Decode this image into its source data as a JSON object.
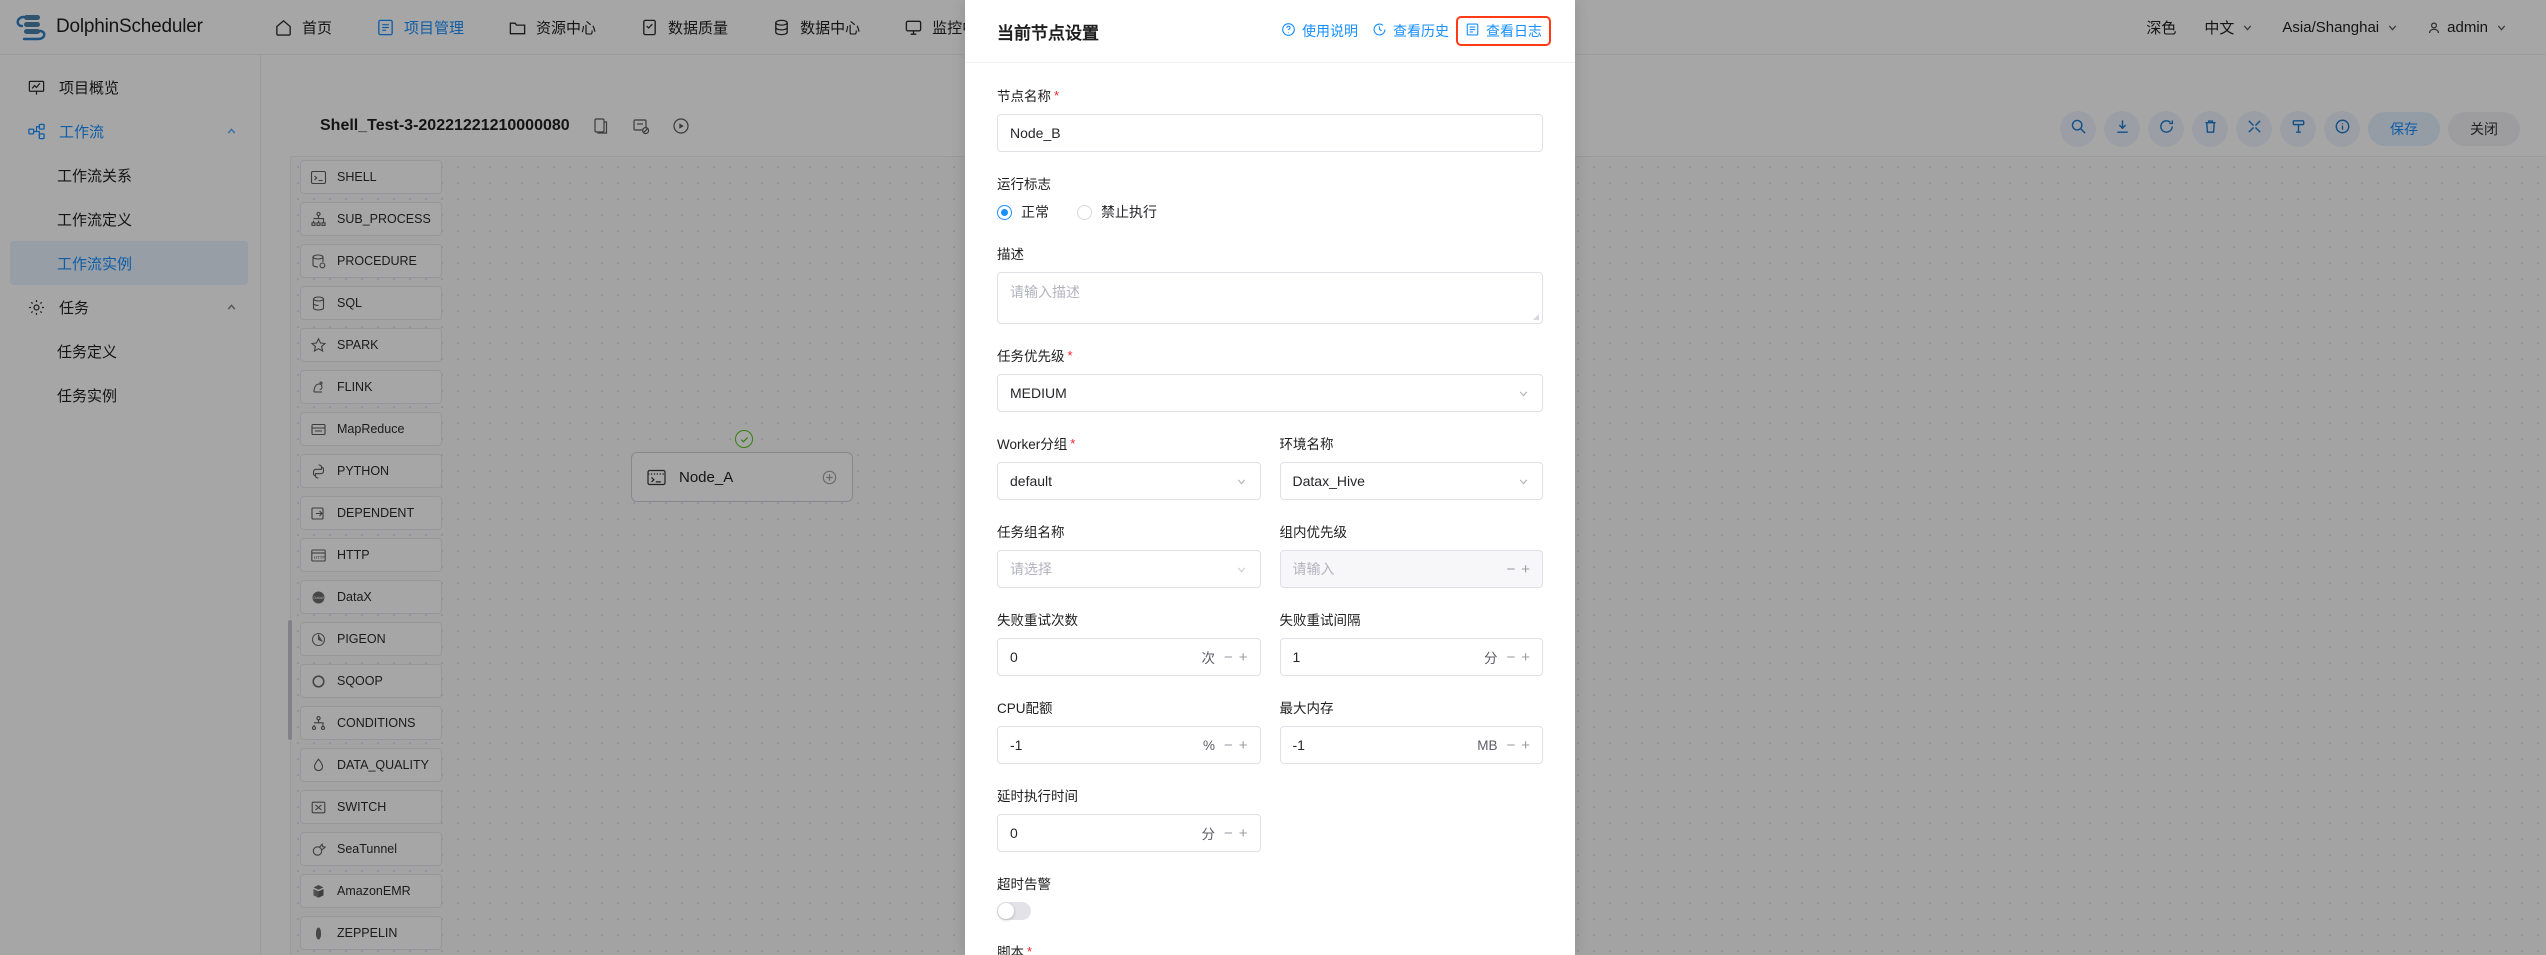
{
  "header": {
    "brand": "DolphinScheduler",
    "nav": [
      {
        "label": "首页",
        "icon": "home-icon",
        "active": false
      },
      {
        "label": "项目管理",
        "icon": "project-icon",
        "active": true
      },
      {
        "label": "资源中心",
        "icon": "folder-icon",
        "active": false
      },
      {
        "label": "数据质量",
        "icon": "quality-icon",
        "active": false
      },
      {
        "label": "数据中心",
        "icon": "datasource-icon",
        "active": false
      },
      {
        "label": "监控中心",
        "icon": "monitor-icon",
        "active": false
      }
    ],
    "right": {
      "theme": "深色",
      "language": "中文",
      "timezone": "Asia/Shanghai",
      "user": "admin"
    }
  },
  "sidebar": {
    "items": [
      {
        "label": "项目概览",
        "icon": "overview-icon",
        "level": "top"
      },
      {
        "label": "工作流",
        "icon": "workflow-icon",
        "level": "top",
        "expanded": true,
        "highlight": true
      },
      {
        "label": "工作流关系",
        "level": "sub"
      },
      {
        "label": "工作流定义",
        "level": "sub"
      },
      {
        "label": "工作流实例",
        "level": "sub",
        "selected": true
      },
      {
        "label": "任务",
        "icon": "gear-icon",
        "level": "top",
        "expanded": true
      },
      {
        "label": "任务定义",
        "level": "sub"
      },
      {
        "label": "任务实例",
        "level": "sub"
      }
    ]
  },
  "palette": {
    "tasks": [
      {
        "label": "SHELL",
        "icon": "shell-icon"
      },
      {
        "label": "SUB_PROCESS",
        "icon": "subprocess-icon"
      },
      {
        "label": "PROCEDURE",
        "icon": "procedure-icon"
      },
      {
        "label": "SQL",
        "icon": "sql-icon"
      },
      {
        "label": "SPARK",
        "icon": "spark-icon"
      },
      {
        "label": "FLINK",
        "icon": "flink-icon"
      },
      {
        "label": "MapReduce",
        "icon": "mapreduce-icon"
      },
      {
        "label": "PYTHON",
        "icon": "python-icon"
      },
      {
        "label": "DEPENDENT",
        "icon": "dependent-icon"
      },
      {
        "label": "HTTP",
        "icon": "http-icon"
      },
      {
        "label": "DataX",
        "icon": "datax-icon"
      },
      {
        "label": "PIGEON",
        "icon": "pigeon-icon"
      },
      {
        "label": "SQOOP",
        "icon": "sqoop-icon"
      },
      {
        "label": "CONDITIONS",
        "icon": "conditions-icon"
      },
      {
        "label": "DATA_QUALITY",
        "icon": "dataquality-icon"
      },
      {
        "label": "SWITCH",
        "icon": "switch-icon"
      },
      {
        "label": "SeaTunnel",
        "icon": "seatunnel-icon"
      },
      {
        "label": "AmazonEMR",
        "icon": "amazonemr-icon"
      },
      {
        "label": "ZEPPELIN",
        "icon": "zeppelin-icon"
      }
    ]
  },
  "canvas": {
    "workflow_name": "Shell_Test-3-20221221210000080",
    "node": {
      "label": "Node_A",
      "status": "success"
    },
    "toolbar": {
      "icons": [
        "search-icon",
        "download-icon",
        "refresh-icon",
        "delete-icon",
        "fullscreen-icon",
        "format-icon",
        "info-icon"
      ],
      "save_label": "保存",
      "close_label": "关闭"
    }
  },
  "modal": {
    "title": "当前节点设置",
    "actions": [
      {
        "label": "使用说明",
        "icon": "question-icon",
        "boxed": false
      },
      {
        "label": "查看历史",
        "icon": "history-icon",
        "boxed": false
      },
      {
        "label": "查看日志",
        "icon": "log-icon",
        "boxed": true
      }
    ],
    "fields": {
      "node_name": {
        "label": "节点名称",
        "required": true,
        "value": "Node_B"
      },
      "run_flag": {
        "label": "运行标志",
        "options": [
          {
            "label": "正常",
            "selected": true
          },
          {
            "label": "禁止执行",
            "selected": false
          }
        ]
      },
      "description": {
        "label": "描述",
        "required": false,
        "placeholder": "请输入描述",
        "value": ""
      },
      "task_priority": {
        "label": "任务优先级",
        "required": true,
        "value": "MEDIUM"
      },
      "worker_group": {
        "label": "Worker分组",
        "required": true,
        "value": "default"
      },
      "environment_name": {
        "label": "环境名称",
        "required": false,
        "value": "Datax_Hive"
      },
      "task_group_name": {
        "label": "任务组名称",
        "required": false,
        "placeholder": "请选择",
        "value": ""
      },
      "group_priority": {
        "label": "组内优先级",
        "required": false,
        "placeholder": "请输入",
        "value": "",
        "disabled": true
      },
      "retry_times": {
        "label": "失败重试次数",
        "value": "0",
        "unit": "次"
      },
      "retry_interval": {
        "label": "失败重试间隔",
        "value": "1",
        "unit": "分"
      },
      "cpu_quota": {
        "label": "CPU配额",
        "value": "-1",
        "unit": "%"
      },
      "max_memory": {
        "label": "最大内存",
        "value": "-1",
        "unit": "MB"
      },
      "delay_time": {
        "label": "延时执行时间",
        "value": "0",
        "unit": "分"
      },
      "timeout_alarm": {
        "label": "超时告警",
        "enabled": false
      },
      "script": {
        "label": "脚本",
        "required": true
      }
    }
  },
  "colors": {
    "accent": "#1890ff",
    "required": "#f5222d",
    "highlight_box": "#ff3b17",
    "success": "#52c41a"
  }
}
